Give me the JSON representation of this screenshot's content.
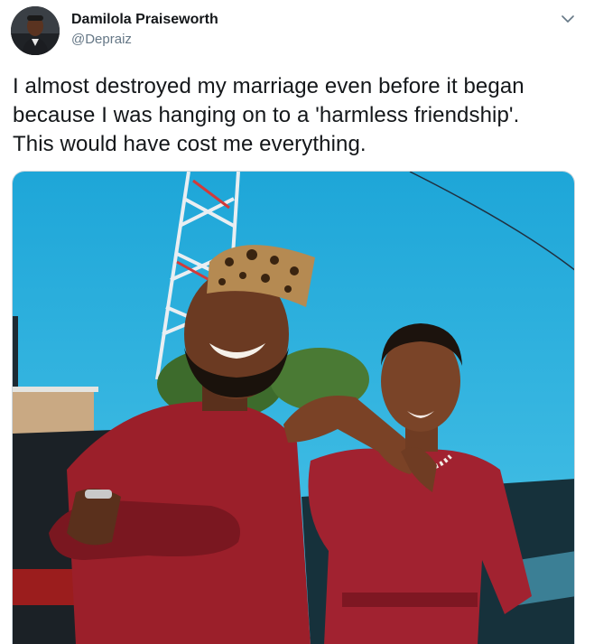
{
  "author": {
    "name": "Damilola Praiseworth",
    "handle": "@Depraiz",
    "avatar_icon": "profile-photo"
  },
  "menu": {
    "icon": "chevron-down-icon"
  },
  "tweet": {
    "lines": [
      "I almost destroyed my marriage even before it began",
      "because I was hanging on to a 'harmless friendship'.",
      "This would have cost me everything."
    ]
  },
  "media": {
    "kind": "photo",
    "colors": {
      "sky": "#2fb6e0",
      "outfit": "#9b1f2a",
      "skin": "#6b3a22"
    }
  }
}
